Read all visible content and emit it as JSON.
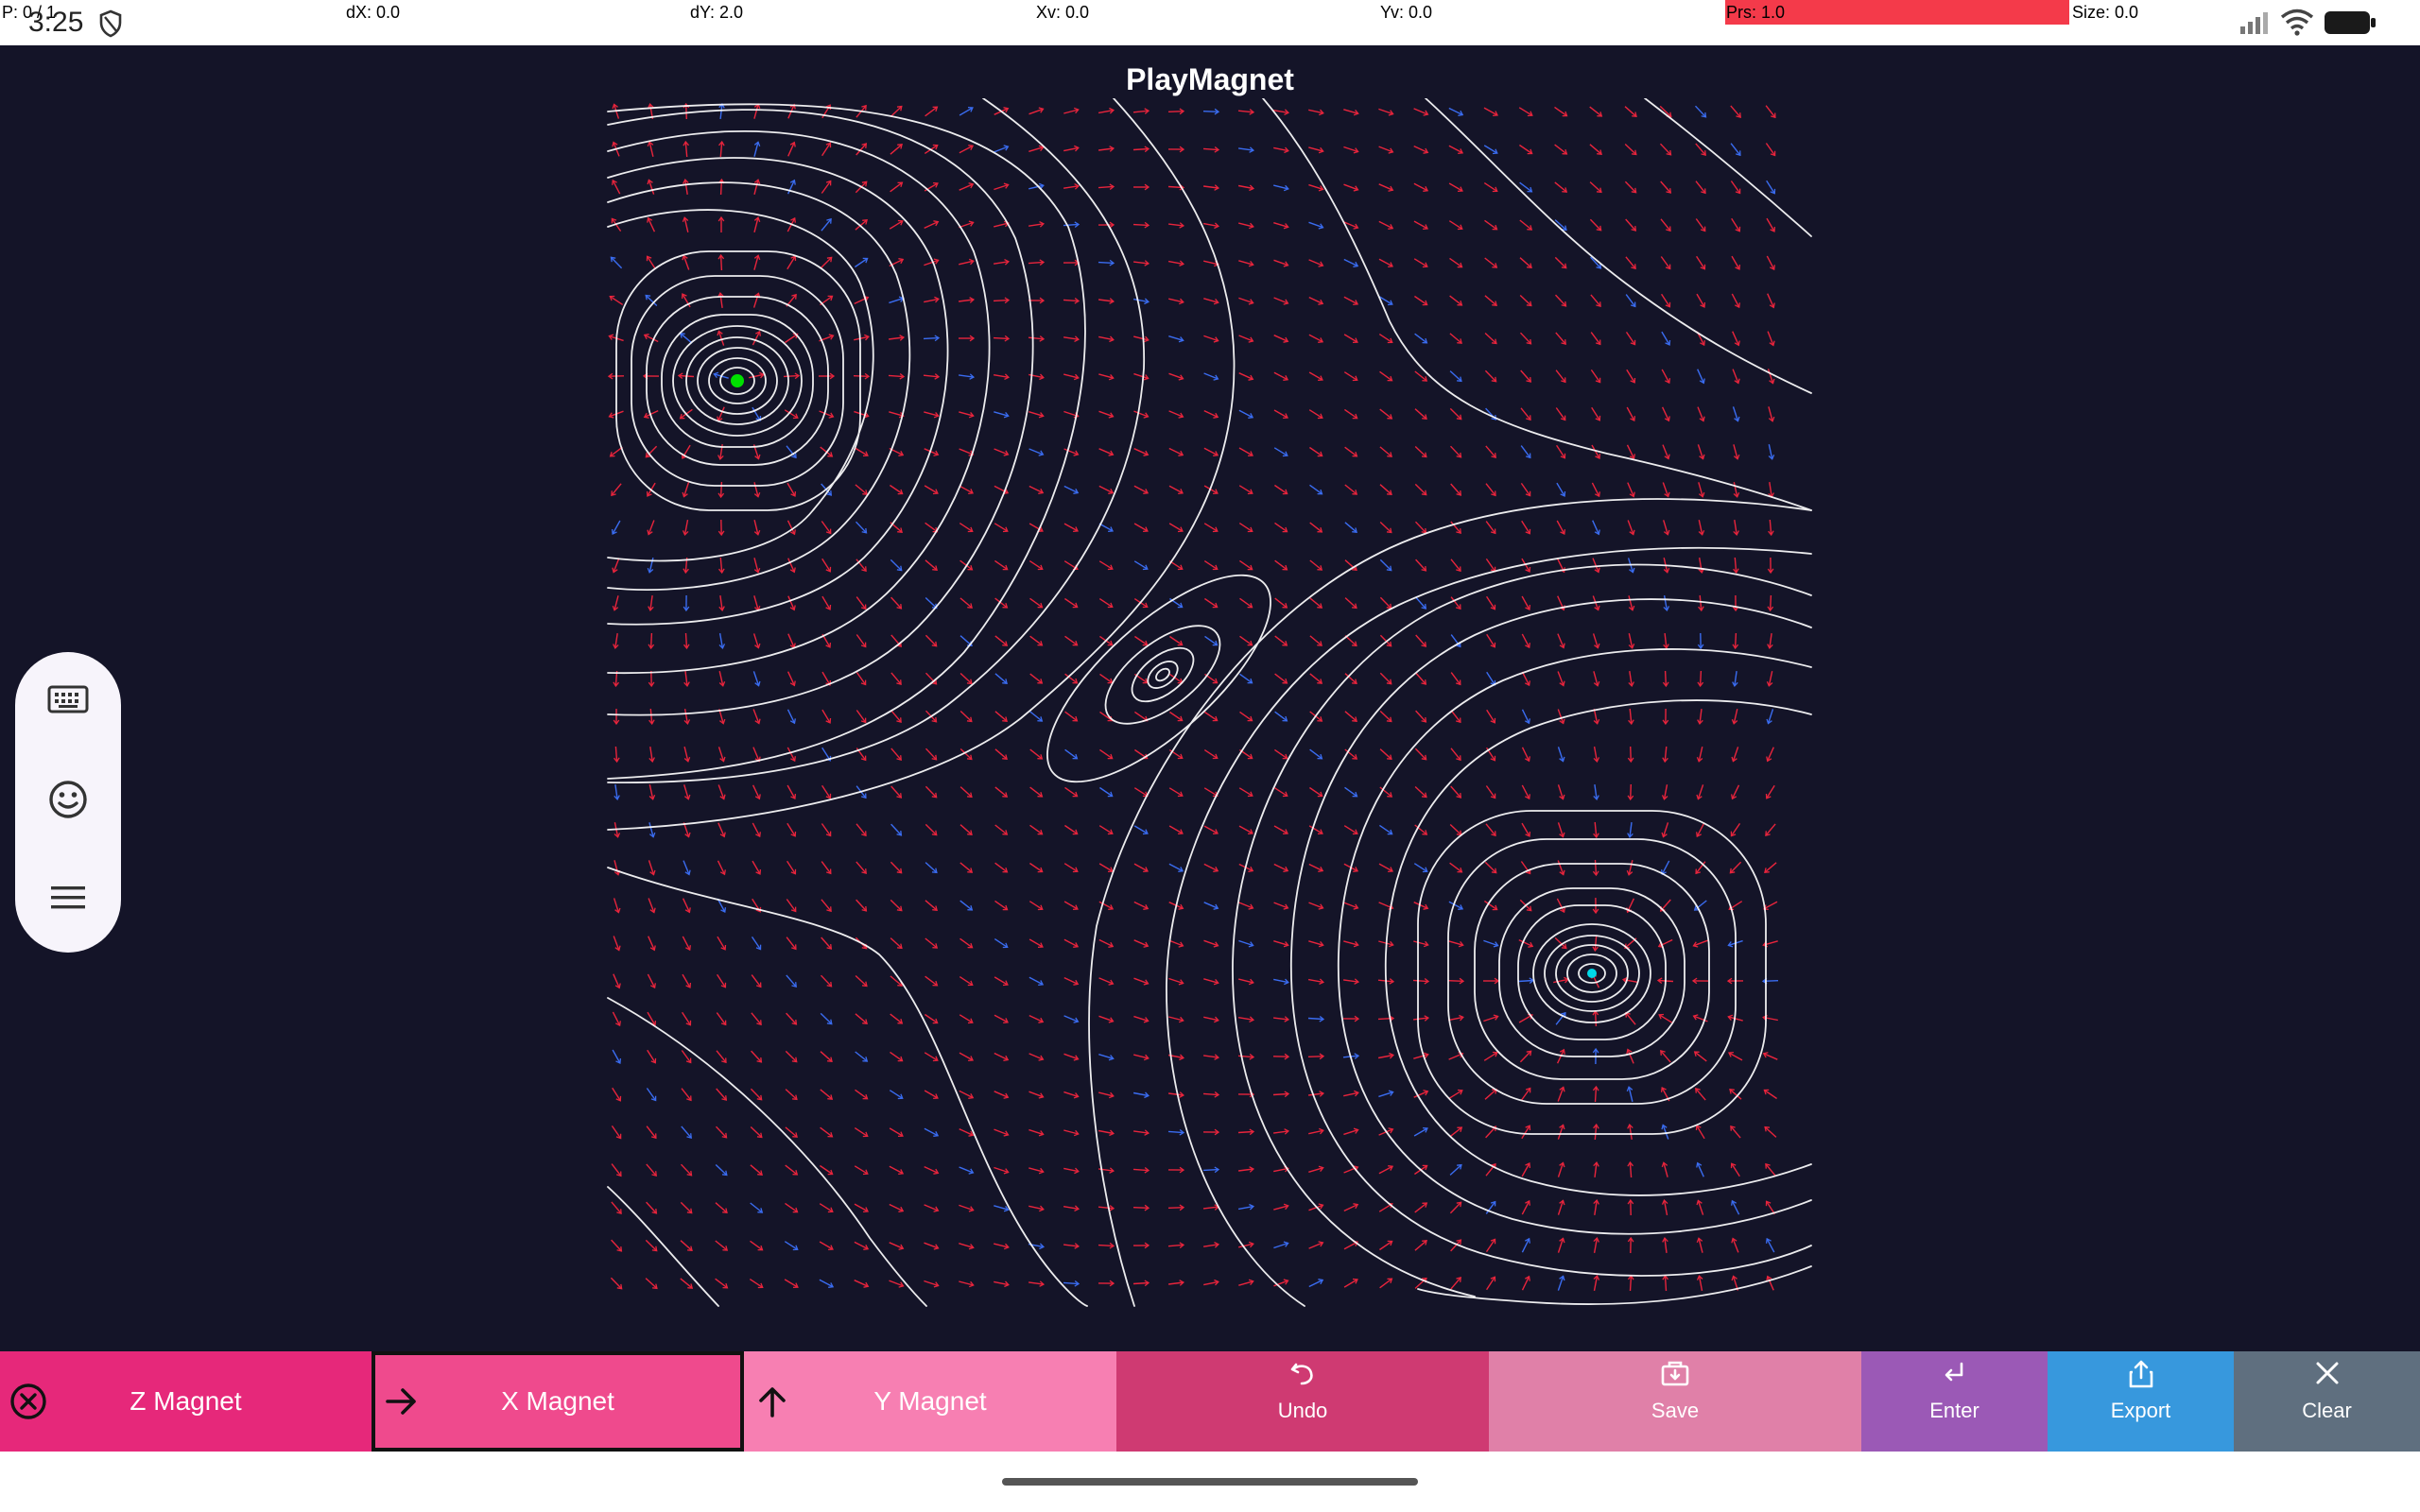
{
  "status_bar": {
    "clock": "3:25",
    "readouts": [
      {
        "id": "p",
        "text": "P: 0 / 1"
      },
      {
        "id": "dx",
        "text": "dX: 0.0"
      },
      {
        "id": "dy",
        "text": "dY: 2.0"
      },
      {
        "id": "xv",
        "text": "Xv: 0.0"
      },
      {
        "id": "yv",
        "text": "Yv: 0.0"
      },
      {
        "id": "prs",
        "text": "Prs: 1.0"
      },
      {
        "id": "size",
        "text": "Size: 0.0"
      }
    ],
    "pressure_fraction": 1.0,
    "icons": [
      "shield-icon",
      "signal-icon",
      "wifi-icon",
      "battery-icon"
    ]
  },
  "app": {
    "title": "PlayMagnet",
    "colors": {
      "background": "#141428",
      "field_line": "#ffffff",
      "arrow_primary": "#e8243c",
      "arrow_secondary": "#3a6cf0",
      "north_pole": "#00e000",
      "south_pole": "#00d8e8"
    },
    "magnets": [
      {
        "name": "north",
        "color": "#00e000"
      },
      {
        "name": "south",
        "color": "#00d8e8"
      }
    ]
  },
  "side_toolbar": {
    "buttons": [
      {
        "name": "keyboard",
        "icon": "keyboard-icon"
      },
      {
        "name": "emoji",
        "icon": "smiley-icon"
      },
      {
        "name": "menu",
        "icon": "hamburger-menu-icon"
      }
    ]
  },
  "toolbar": {
    "z_magnet": {
      "label": "Z Magnet",
      "icon": "close-circle-icon",
      "color": "#e6287a"
    },
    "x_magnet": {
      "label": "X Magnet",
      "icon": "arrow-right-icon",
      "color": "#ef4a8d",
      "selected": true
    },
    "y_magnet": {
      "label": "Y Magnet",
      "icon": "arrow-up-icon",
      "color": "#f77fb2"
    },
    "undo": {
      "label": "Undo",
      "icon": "undo-icon",
      "color": "#cf3a72"
    },
    "save": {
      "label": "Save",
      "icon": "save-icon",
      "color": "#e080a8"
    },
    "enter": {
      "label": "Enter",
      "icon": "enter-icon",
      "color": "#9b59b6"
    },
    "export": {
      "label": "Export",
      "icon": "share-icon",
      "color": "#3798dd"
    },
    "clear": {
      "label": "Clear",
      "icon": "close-icon",
      "color": "#5f6f7f"
    }
  }
}
